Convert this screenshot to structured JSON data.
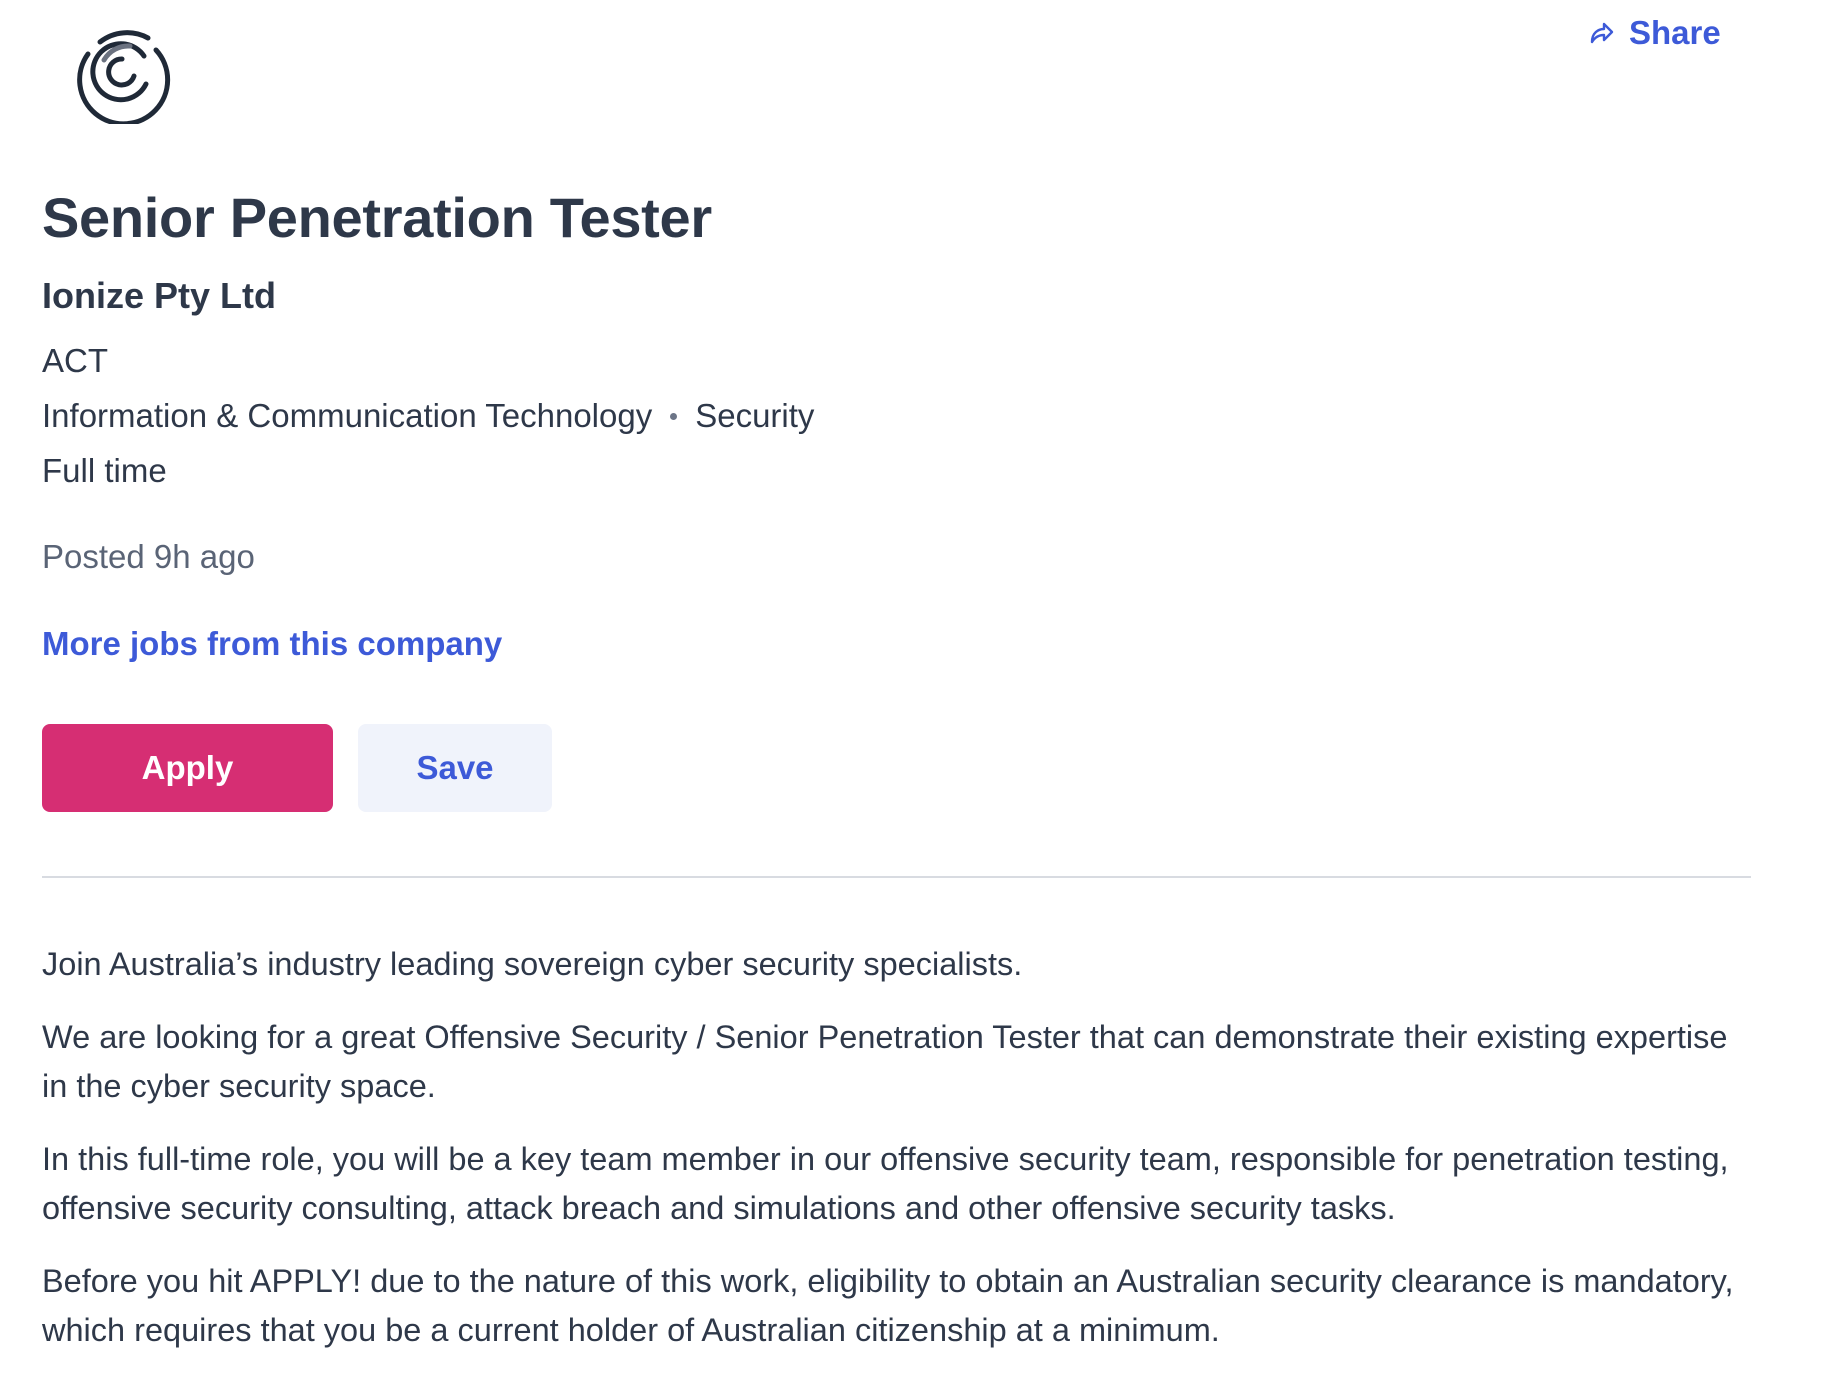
{
  "header": {
    "logo_icon": "concentric-arcs-logo-icon",
    "share_icon": "share-arrow-icon",
    "share_label": "Share"
  },
  "job": {
    "title": "Senior Penetration Tester",
    "company": "Ionize Pty Ltd",
    "location": "ACT",
    "classification": "Information & Communication Technology",
    "subclassification": "Security",
    "work_type": "Full time",
    "posted": "Posted 9h ago",
    "more_jobs_link": "More jobs from this company"
  },
  "actions": {
    "apply_label": "Apply",
    "save_label": "Save"
  },
  "description": {
    "paragraphs": [
      "Join Australia’s industry leading sovereign cyber security specialists.",
      "We are looking for a great Offensive Security / Senior Penetration Tester that can demonstrate their existing expertise in the cyber security space.",
      "In this full-time role, you will be a key team member in our offensive security team, responsible for penetration testing, offensive security consulting, attack breach and simulations and other offensive security tasks.",
      "Before you hit APPLY! due to the nature of this work, eligibility to obtain an Australian security clearance is mandatory, which requires that you be a current holder of Australian citizenship at a minimum."
    ]
  },
  "colors": {
    "accent_link": "#3d5ad8",
    "apply_button": "#d62e73",
    "save_button_bg": "#f0f3fb",
    "text_primary": "#2e3849",
    "text_secondary": "#5a6476"
  }
}
